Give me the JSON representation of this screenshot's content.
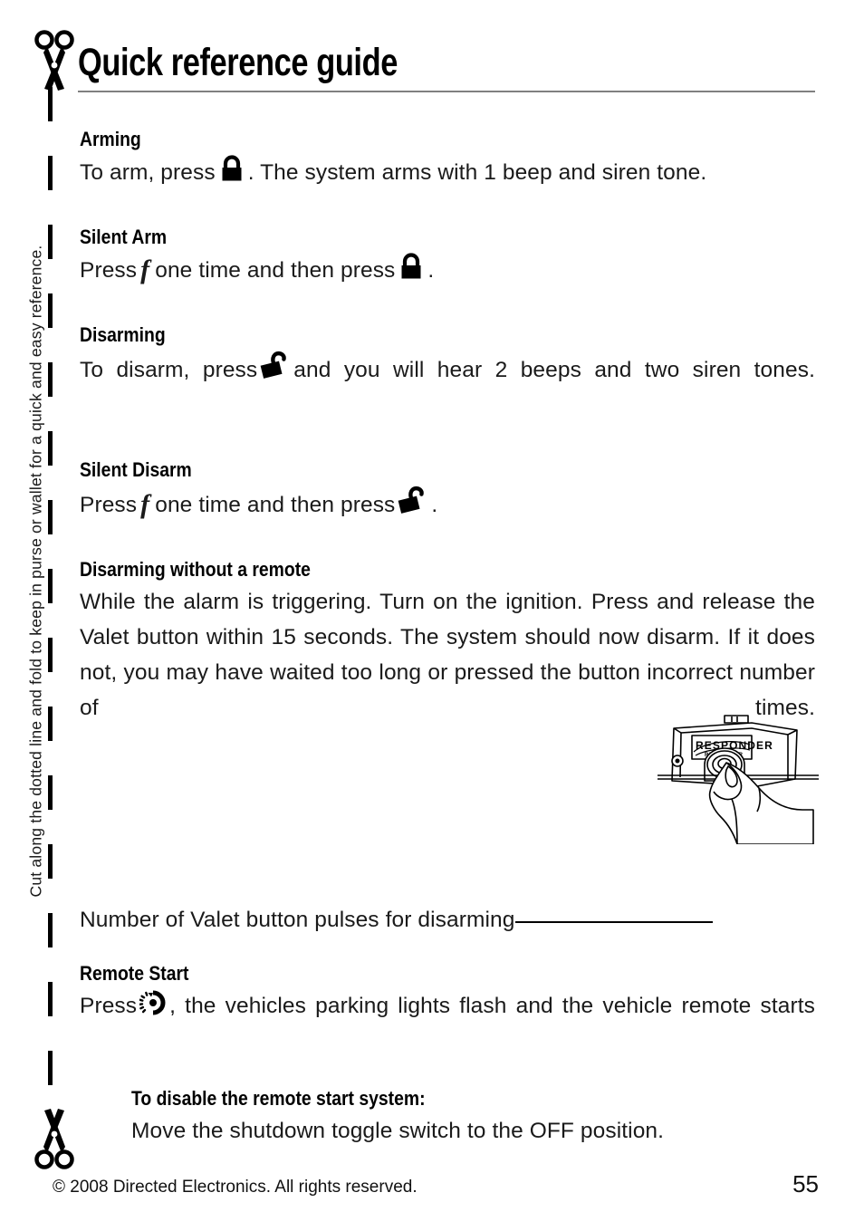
{
  "document": {
    "title": "Quick reference guide",
    "side_note": "Cut along the dotted line and fold to keep in purse or wallet for a quick and easy reference.",
    "rule_color": "#808080",
    "text_color": "#000000"
  },
  "icons": {
    "scissors_top": "scissors-icon",
    "scissors_bottom": "scissors-icon",
    "lock": "lock-closed-icon",
    "unlock": "lock-open-icon",
    "remote_start": "remote-start-dial-icon",
    "f_button": "f-button-glyph"
  },
  "sections": [
    {
      "heading": "Arming",
      "parts": [
        {
          "type": "text",
          "value": "To arm, press "
        },
        {
          "type": "icon",
          "value": "lock"
        },
        {
          "type": "text",
          "value": ". The system arms with 1 beep and siren tone."
        }
      ]
    },
    {
      "heading": "Silent Arm",
      "parts": [
        {
          "type": "text",
          "value": "Press "
        },
        {
          "type": "icon",
          "value": "f"
        },
        {
          "type": "text",
          "value": " one time and then press "
        },
        {
          "type": "icon",
          "value": "lock"
        },
        {
          "type": "text",
          "value": "."
        }
      ]
    },
    {
      "heading": "Disarming",
      "parts": [
        {
          "type": "text",
          "value": "To disarm, press "
        },
        {
          "type": "icon",
          "value": "unlock"
        },
        {
          "type": "text",
          "value": " and you will hear 2 beeps and two siren tones."
        }
      ]
    },
    {
      "heading": "Silent Disarm",
      "parts": [
        {
          "type": "text",
          "value": "Press "
        },
        {
          "type": "icon",
          "value": "f"
        },
        {
          "type": "text",
          "value": " one time and then press "
        },
        {
          "type": "icon",
          "value": "unlock"
        },
        {
          "type": "text",
          "value": "."
        }
      ]
    },
    {
      "heading": "Disarming without a remote",
      "parts": [
        {
          "type": "text",
          "value": "While the alarm is triggering. Turn on the ignition. Press and release the Valet button within 15 seconds. The system should now disarm. If it does not, you may have waited too long or pressed the button incorrect number of times."
        }
      ]
    },
    {
      "heading": "Remote Start",
      "parts": [
        {
          "type": "text",
          "value": "Press "
        },
        {
          "type": "icon",
          "value": "remote_start"
        },
        {
          "type": "text",
          "value": ", the vehicles parking lights flash and the vehicle remote starts"
        }
      ]
    }
  ],
  "text": {
    "arming_heading": "Arming",
    "arming_before": "To arm, press",
    "arming_after": ". The system arms with 1 beep and siren tone.",
    "silent_arm_heading": "Silent Arm",
    "silent_arm_before": "Press",
    "silent_arm_middle": "one time and then press",
    "silent_arm_after": ".",
    "disarming_heading": "Disarming",
    "disarming_before": "To disarm, press",
    "disarming_after": "and you will hear 2 beeps and two siren tones.",
    "silent_disarm_heading": "Silent Disarm",
    "silent_disarm_before": "Press",
    "silent_disarm_middle": "one time and then press",
    "silent_disarm_after": ".",
    "no_remote_heading": "Disarming without a remote",
    "no_remote_body": "While the alarm is triggering. Turn on the ignition. Press and release the Valet button within 15 seconds. The system should now disarm. If it does not, you may have waited too long or pressed the button incorrect number of times.",
    "valet_pulses_label": "Number of Valet button pulses for disarming",
    "remote_start_heading": "Remote Start",
    "remote_start_before": "Press",
    "remote_start_after": ", the vehicles parking lights flash and the vehicle remote starts",
    "disable_heading": "To disable the remote start system:",
    "disable_body": "Move the shutdown toggle switch to the OFF position."
  },
  "figure": {
    "name": "valet-button-illustration",
    "device_label": "RESPONDER",
    "device_sublabel": "RESPONDER"
  },
  "footer": {
    "copyright": "© 2008 Directed Electronics. All rights reserved.",
    "page_number": "55"
  }
}
